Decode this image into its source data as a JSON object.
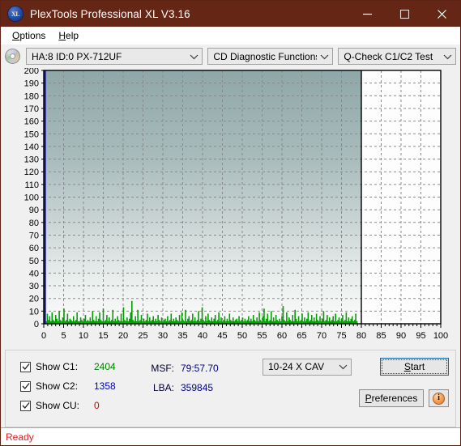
{
  "window": {
    "title": "PlexTools Professional XL V3.16",
    "app_icon": "xl-disc-icon",
    "minimize_label": "Minimize",
    "maximize_label": "Maximize",
    "close_label": "Close"
  },
  "menu": {
    "items": [
      {
        "label": "Options",
        "accel": "O"
      },
      {
        "label": "Help",
        "accel": "H"
      }
    ]
  },
  "toolbar": {
    "drive_select": "HA:8 ID:0  PX-712UF",
    "function_select": "CD Diagnostic Functions",
    "test_select": "Q-Check C1/C2 Test"
  },
  "chart_data": {
    "type": "bar",
    "title": "",
    "xlabel": "",
    "ylabel": "",
    "xlim": [
      0,
      100
    ],
    "ylim": [
      0,
      200
    ],
    "y_ticks": [
      0,
      10,
      20,
      30,
      40,
      50,
      60,
      70,
      80,
      90,
      100,
      110,
      120,
      130,
      140,
      150,
      160,
      170,
      180,
      190,
      200
    ],
    "x_ticks": [
      0,
      5,
      10,
      15,
      20,
      25,
      30,
      35,
      40,
      45,
      50,
      55,
      60,
      65,
      70,
      75,
      80,
      85,
      90,
      95,
      100
    ],
    "grid": true,
    "data_end_x": 80,
    "series": [
      {
        "name": "C1",
        "color": "#00a000",
        "x": [
          0.3,
          0.6,
          0.9,
          1.2,
          1.5,
          1.8,
          2.1,
          2.4,
          2.7,
          3.0,
          3.3,
          3.6,
          3.9,
          4.2,
          4.5,
          4.8,
          5.1,
          5.4,
          5.7,
          6.0,
          6.3,
          6.6,
          6.9,
          7.2,
          7.5,
          7.8,
          8.1,
          8.4,
          8.7,
          9.0,
          9.3,
          9.6,
          9.9,
          10.2,
          10.5,
          10.8,
          11.1,
          11.4,
          11.7,
          12.0,
          12.3,
          12.6,
          12.9,
          13.2,
          13.5,
          13.8,
          14.1,
          14.4,
          14.7,
          15.0,
          15.3,
          15.6,
          15.9,
          16.2,
          16.5,
          16.8,
          17.1,
          17.4,
          17.7,
          18.0,
          18.3,
          18.6,
          18.9,
          19.2,
          19.5,
          19.8,
          20.1,
          20.4,
          20.7,
          21.0,
          21.3,
          21.6,
          21.9,
          22.2,
          22.5,
          22.8,
          23.1,
          23.4,
          23.7,
          24.0,
          24.3,
          24.6,
          24.9,
          25.2,
          25.5,
          25.8,
          26.1,
          26.4,
          26.7,
          27.0,
          27.3,
          27.6,
          27.9,
          28.2,
          28.5,
          28.8,
          29.1,
          29.4,
          29.7,
          30.0,
          30.3,
          30.6,
          30.9,
          31.2,
          31.5,
          31.8,
          32.1,
          32.4,
          32.7,
          33.0,
          33.3,
          33.6,
          33.9,
          34.2,
          34.5,
          34.8,
          35.1,
          35.4,
          35.7,
          36.0,
          36.3,
          36.6,
          36.9,
          37.2,
          37.5,
          37.8,
          38.1,
          38.4,
          38.7,
          39.0,
          39.3,
          39.6,
          39.9,
          40.2,
          40.5,
          40.8,
          41.1,
          41.4,
          41.7,
          42.0,
          42.3,
          42.6,
          42.9,
          43.2,
          43.5,
          43.8,
          44.1,
          44.4,
          44.7,
          45.0,
          45.3,
          45.6,
          45.9,
          46.2,
          46.5,
          46.8,
          47.1,
          47.4,
          47.7,
          48.0,
          48.3,
          48.6,
          48.9,
          49.2,
          49.5,
          49.8,
          50.1,
          50.4,
          50.7,
          51.0,
          51.3,
          51.6,
          51.9,
          52.2,
          52.5,
          52.8,
          53.1,
          53.4,
          53.7,
          54.0,
          54.3,
          54.6,
          54.9,
          55.2,
          55.5,
          55.8,
          56.1,
          56.4,
          56.7,
          57.0,
          57.3,
          57.6,
          57.9,
          58.2,
          58.5,
          58.8,
          59.1,
          59.4,
          59.7,
          60.0,
          60.3,
          60.6,
          60.9,
          61.2,
          61.5,
          61.8,
          62.1,
          62.4,
          62.7,
          63.0,
          63.3,
          63.6,
          63.9,
          64.2,
          64.5,
          64.8,
          65.1,
          65.4,
          65.7,
          66.0,
          66.3,
          66.6,
          66.9,
          67.2,
          67.5,
          67.8,
          68.1,
          68.4,
          68.7,
          69.0,
          69.3,
          69.6,
          69.9,
          70.2,
          70.5,
          70.8,
          71.1,
          71.4,
          71.7,
          72.0,
          72.3,
          72.6,
          72.9,
          73.2,
          73.5,
          73.8,
          74.1,
          74.4,
          74.7,
          75.0,
          75.3,
          75.6,
          75.9,
          76.2,
          76.5,
          76.8,
          77.1,
          77.4,
          77.7,
          78.0,
          78.3,
          78.6,
          78.9,
          79.2,
          79.5,
          79.8
        ],
        "values": [
          4,
          2,
          8,
          3,
          6,
          2,
          9,
          3,
          2,
          7,
          4,
          2,
          10,
          3,
          2,
          5,
          12,
          2,
          3,
          8,
          2,
          4,
          3,
          2,
          6,
          2,
          3,
          9,
          2,
          2,
          5,
          3,
          2,
          4,
          7,
          2,
          3,
          2,
          5,
          2,
          10,
          3,
          2,
          6,
          2,
          4,
          9,
          3,
          2,
          12,
          2,
          3,
          7,
          2,
          5,
          2,
          3,
          11,
          2,
          4,
          2,
          6,
          3,
          2,
          8,
          2,
          13,
          3,
          2,
          5,
          2,
          4,
          9,
          18,
          3,
          2,
          6,
          2,
          11,
          2,
          3,
          7,
          2,
          4,
          2,
          3,
          8,
          2,
          5,
          2,
          3,
          6,
          2,
          4,
          2,
          7,
          3,
          2,
          5,
          2,
          3,
          4,
          2,
          6,
          2,
          3,
          8,
          2,
          4,
          2,
          5,
          3,
          2,
          7,
          2,
          9,
          3,
          2,
          11,
          2,
          4,
          6,
          2,
          3,
          8,
          2,
          5,
          2,
          3,
          10,
          2,
          4,
          13,
          3,
          2,
          6,
          2,
          8,
          3,
          2,
          5,
          2,
          4,
          7,
          2,
          3,
          9,
          2,
          5,
          2,
          3,
          6,
          2,
          4,
          2,
          8,
          3,
          2,
          5,
          2,
          3,
          4,
          2,
          6,
          2,
          3,
          5,
          2,
          4,
          2,
          3,
          6,
          2,
          4,
          2,
          7,
          3,
          2,
          5,
          2,
          9,
          3,
          2,
          6,
          12,
          2,
          4,
          8,
          2,
          3,
          10,
          2,
          5,
          2,
          7,
          3,
          2,
          4,
          2,
          6,
          14,
          3,
          2,
          9,
          2,
          5,
          3,
          2,
          7,
          2,
          11,
          4,
          2,
          6,
          2,
          3,
          8,
          2,
          5,
          2,
          4,
          9,
          2,
          3,
          7,
          2,
          5,
          2,
          8,
          3,
          2,
          6,
          2,
          4,
          10,
          2,
          3,
          7,
          2,
          5,
          2,
          3,
          6,
          2,
          8,
          2,
          3,
          5,
          2,
          4,
          7,
          2,
          3,
          9,
          2,
          5,
          2,
          4,
          6,
          2,
          3,
          8,
          2
        ]
      }
    ]
  },
  "results": {
    "checkboxes": [
      {
        "label": "Show C1:",
        "value": "2404",
        "checked": true,
        "color": "#008000"
      },
      {
        "label": "Show C2:",
        "value": "1358",
        "checked": true,
        "color": "#0000c0"
      },
      {
        "label": "Show CU:",
        "value": "0",
        "checked": true,
        "color": "#d00000"
      }
    ],
    "msf_key": "MSF:",
    "msf_value": "79:57.70",
    "lba_key": "LBA:",
    "lba_value": "359845",
    "speed_select": "10-24 X CAV",
    "start_label": "Start",
    "start_accel": "S",
    "preferences_label": "Preferences",
    "preferences_accel": "P",
    "info_label": "i"
  },
  "statusbar": {
    "text": "Ready"
  }
}
